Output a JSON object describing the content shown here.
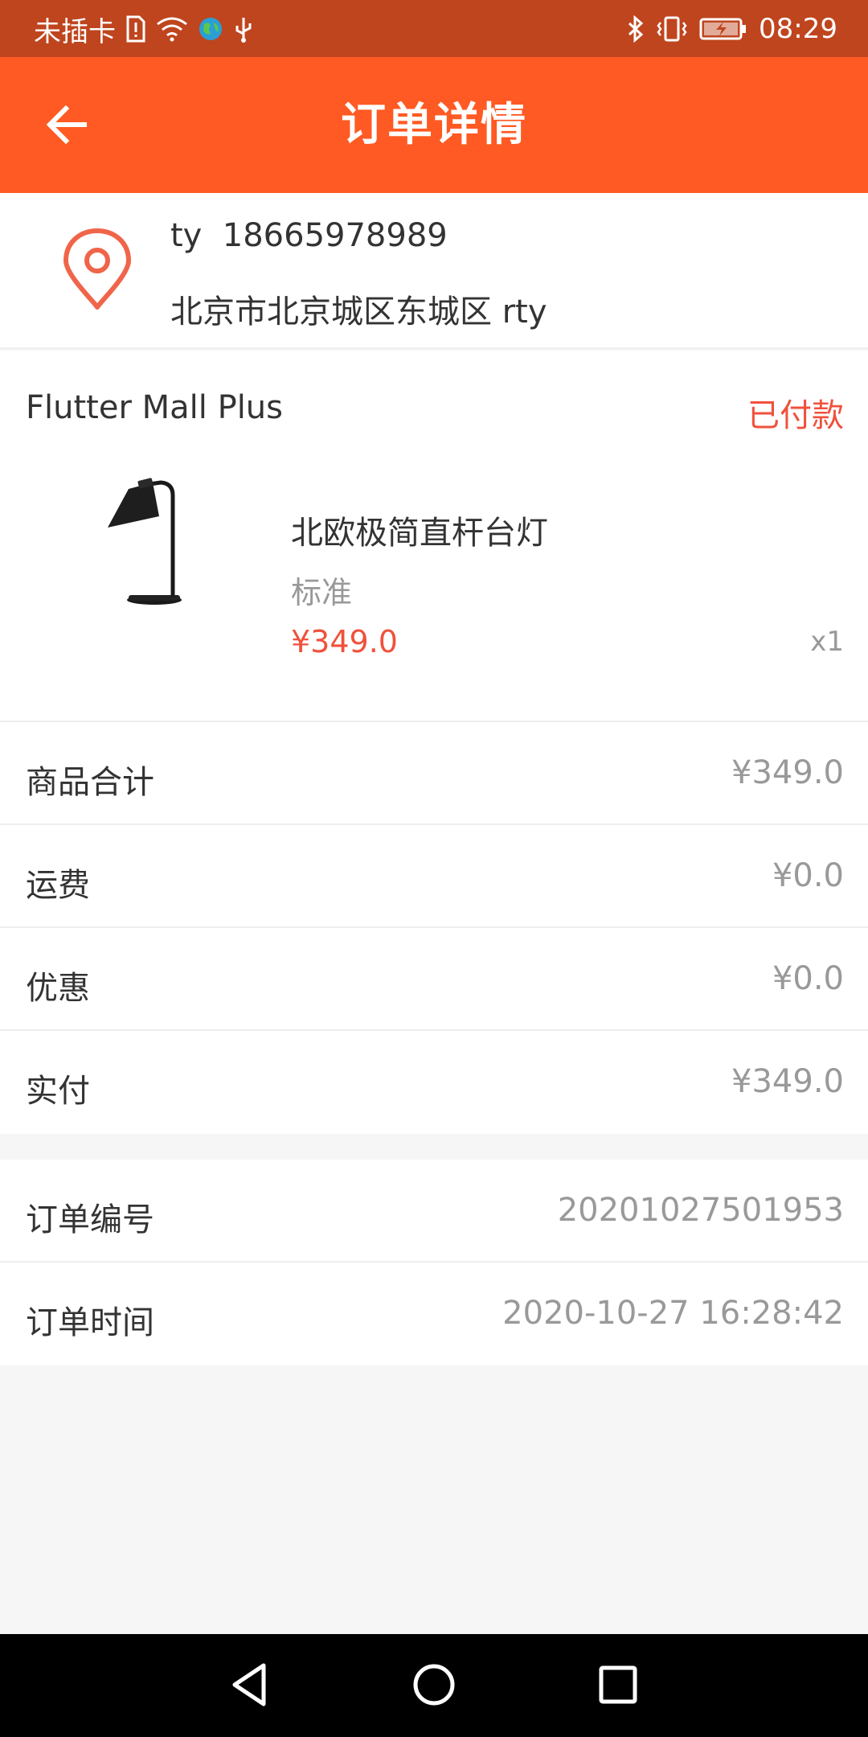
{
  "status_bar": {
    "carrier": "未插卡",
    "time": "08:29",
    "icons": [
      "sim-alert-icon",
      "wifi-icon",
      "globe-icon",
      "usb-icon",
      "bluetooth-icon",
      "vibrate-icon",
      "battery-charging-icon"
    ]
  },
  "header": {
    "title": "订单详情",
    "back_icon": "arrow-left-icon"
  },
  "address": {
    "icon": "location-pin-icon",
    "name_phone": "ty  18665978989",
    "detail": "北京市北京城区东城区 rty"
  },
  "order": {
    "shop_name": "Flutter Mall Plus",
    "status": "已付款",
    "product": {
      "name": "北欧极简直杆台灯",
      "spec": "标准",
      "price": "¥349.0",
      "quantity": "x1"
    }
  },
  "summary": [
    {
      "label": "商品合计",
      "value": "¥349.0"
    },
    {
      "label": "运费",
      "value": "¥0.0"
    },
    {
      "label": "优惠",
      "value": "¥0.0"
    },
    {
      "label": "实付",
      "value": "¥349.0"
    }
  ],
  "order_info": [
    {
      "label": "订单编号",
      "value": "20201027501953"
    },
    {
      "label": "订单时间",
      "value": "2020-10-27 16:28:42"
    }
  ],
  "nav_bar": {
    "buttons": [
      "back-triangle-icon",
      "home-circle-icon",
      "recents-square-icon"
    ]
  },
  "colors": {
    "status_bar": "#bf451e",
    "app_bar": "#ff5a23",
    "accent_red": "#f0513c",
    "secondary_text": "#999999"
  }
}
